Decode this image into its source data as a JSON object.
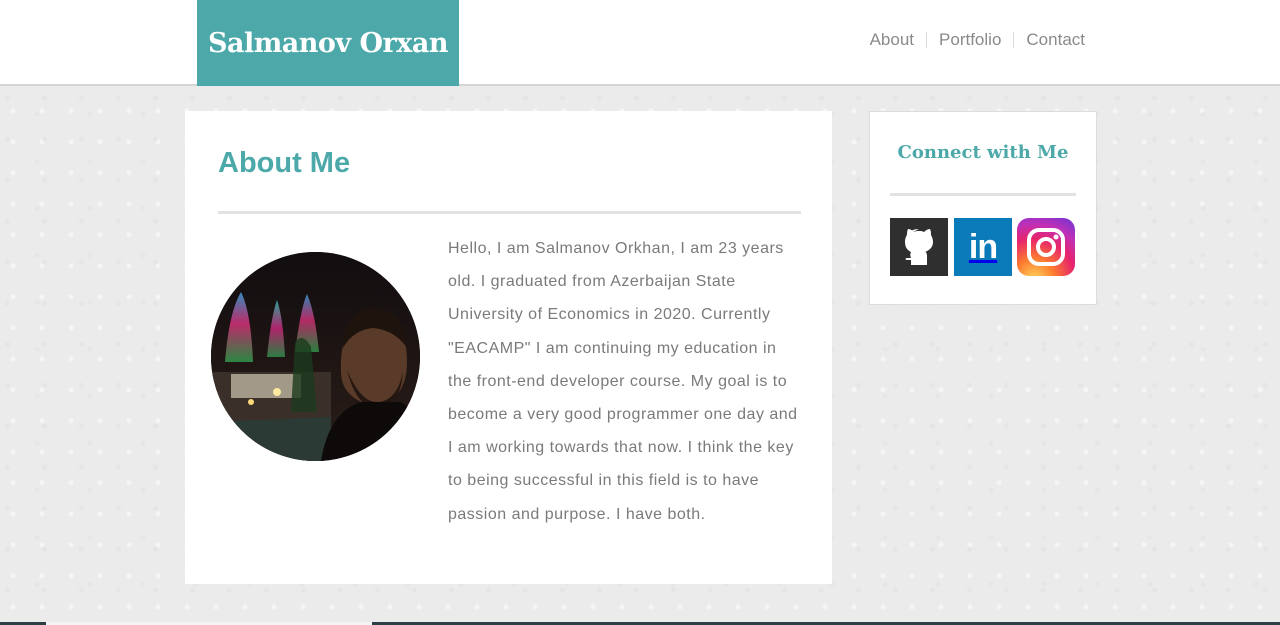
{
  "header": {
    "logo_text": "Salmanov Orxan",
    "nav": [
      {
        "label": "About"
      },
      {
        "label": "Portfolio"
      },
      {
        "label": "Contact"
      }
    ]
  },
  "about": {
    "title": "About Me",
    "text": "Hello, I am Salmanov Orkhan, I am 23 years old. I graduated from Azerbaijan State University of Economics in 2020. Currently \"EACAMP\" I am continuing my education in the front-end developer course. My goal is to become a very good programmer one day and I am working towards that now. I think the key to being successful in this field is to have passion and purpose. I have both."
  },
  "connect": {
    "title": "Connect with Me",
    "socials": [
      {
        "name": "github-icon",
        "label": "GitHub"
      },
      {
        "name": "linkedin-icon",
        "label": "in"
      },
      {
        "name": "instagram-icon",
        "label": "Instagram"
      }
    ]
  },
  "colors": {
    "accent": "#4ca8a9",
    "linkedin": "#0a7ab8",
    "github": "#2f2f2f"
  }
}
